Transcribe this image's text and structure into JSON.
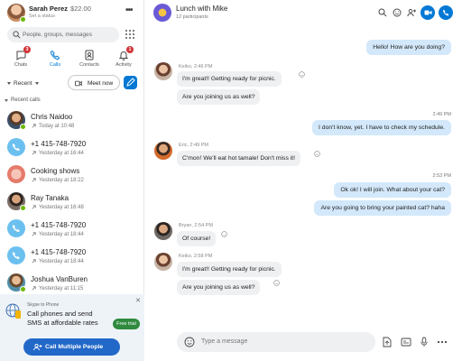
{
  "profile": {
    "name": "Sarah Perez",
    "credit": "$22.00",
    "status": "Set a status"
  },
  "search": {
    "placeholder": "People, groups, messages"
  },
  "nav": [
    {
      "label": "Chats",
      "badge": "3",
      "icon": "chat-icon"
    },
    {
      "label": "Calls",
      "badge": "",
      "icon": "phone-icon"
    },
    {
      "label": "Contacts",
      "badge": "",
      "icon": "contacts-icon"
    },
    {
      "label": "Activity",
      "badge": "1",
      "icon": "bell-icon"
    }
  ],
  "filter": {
    "label": "Recent"
  },
  "meet_now": {
    "label": "Meet now"
  },
  "section": {
    "label": "Recent calls"
  },
  "calls": [
    {
      "name": "Chris Naidoo",
      "time": "Today at 10:48",
      "avatar": "person"
    },
    {
      "name": "+1 415-748-7920",
      "time": "Yesterday at 16:44",
      "avatar": "phone"
    },
    {
      "name": "Cooking shows",
      "time": "Yesterday at 18:22",
      "avatar": "group"
    },
    {
      "name": "Ray Tanaka",
      "time": "Yesterday at 16:48",
      "avatar": "person"
    },
    {
      "name": "+1 415-748-7920",
      "time": "Yesterday at 18:44",
      "avatar": "phone"
    },
    {
      "name": "+1 415-748-7920",
      "time": "Yesterday at 18:44",
      "avatar": "phone"
    },
    {
      "name": "Joshua VanBuren",
      "time": "Yesterday at 11:15",
      "avatar": "person"
    }
  ],
  "promo": {
    "heading": "Skype to Phone",
    "text": "Call phones and send SMS at affordable rates",
    "button": "Free trial"
  },
  "call_multiple": {
    "label": "Call Multiple People"
  },
  "chat": {
    "title": "Lunch with Mike",
    "subtitle": "12 participants",
    "input_placeholder": "Type a message"
  },
  "messages": {
    "m1": "Hello! How are you doing?",
    "k1_sender": "Keiko, 2:46 PM",
    "k1a": "I'm great!! Getting ready for picnic.",
    "k1b": "Are you joining us as well?",
    "t2": "2:49 PM",
    "m2": "I don't know, yet. I have to check my schedule.",
    "e_sender": "Eric, 2:49 PM",
    "e1": "C'mon! We'll eat hot tamale! Don't miss it!",
    "t3": "2:53 PM",
    "m3a": "Ok ok! I will join. What about your cat?",
    "m3b": "Are you going to bring your painted cat? haha",
    "b_sender": "Bryan, 2:54 PM",
    "b1": "Of course!",
    "k2_sender": "Keiko, 2:58 PM",
    "k2a": "I'm great!! Getting ready for picnic.",
    "k2b": "Are you joining us as well?"
  },
  "colors": {
    "accent": "#0078d4",
    "outgoing_bubble": "#d3e8fa",
    "incoming_bubble": "#eef0f2",
    "badge": "#d13438",
    "online": "#6bb700",
    "promo_button": "#2f8a3e"
  }
}
